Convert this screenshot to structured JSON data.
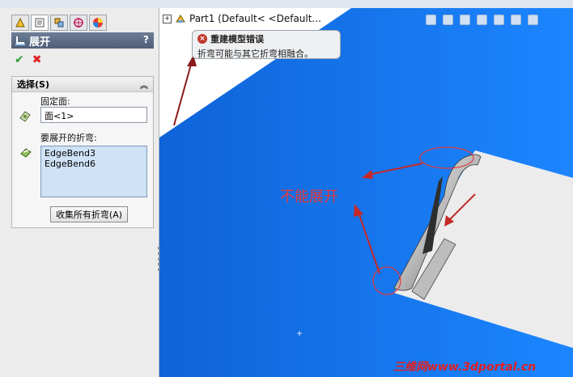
{
  "feature_manager": {
    "tabs": [
      {
        "name": "feature-tree-tab",
        "icon": "feature-tree-icon"
      },
      {
        "name": "property-manager-tab",
        "icon": "property-manager-icon"
      },
      {
        "name": "configuration-tab",
        "icon": "configuration-icon"
      },
      {
        "name": "dimxpert-tab",
        "icon": "dimxpert-icon"
      },
      {
        "name": "display-tab",
        "icon": "display-manager-icon"
      }
    ]
  },
  "property_panel": {
    "title": "展开",
    "help": "?",
    "ok_icon": "✔",
    "cancel_icon": "✖",
    "group_title": "选择(S)",
    "fixed_face_label": "固定面:",
    "fixed_face_value": "面<1>",
    "bends_label": "要展开的折弯:",
    "bends": [
      "EdgeBend3",
      "EdgeBend6"
    ],
    "collect_button": "收集所有折弯(A)"
  },
  "tree": {
    "expand": "+",
    "part_label": "Part1  (Default< <Default..."
  },
  "tooltip": {
    "title": "重建模型错误",
    "message": "折弯可能与其它折弯相融合。"
  },
  "annotation": "不能展开",
  "watermark": "三维网www.3dportal.cn",
  "colors": {
    "viewport_blue": "#1677f0",
    "panel_bg": "#ececec",
    "annotation_red": "#e23b3b",
    "title_bar": "#5a6b84"
  }
}
